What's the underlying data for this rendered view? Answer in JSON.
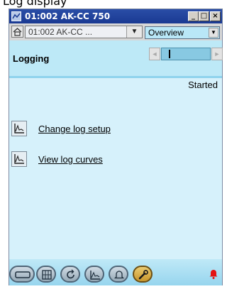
{
  "caption": "Log display",
  "window": {
    "title": "01:002 AK-CC 750",
    "controls": {
      "minimize": "_",
      "maximize": "□",
      "close": "×"
    }
  },
  "nav": {
    "device_selected": "01:002 AK-CC ...",
    "view_selected": "Overview"
  },
  "header": {
    "title": "Logging",
    "pager": {
      "prev": "◄",
      "next": "►",
      "value": ""
    }
  },
  "content": {
    "status": "Started",
    "links": [
      {
        "label": "Change log setup",
        "icon": "chart-icon"
      },
      {
        "label": "View log curves",
        "icon": "chart-icon"
      }
    ]
  },
  "toolbar": {
    "buttons": [
      {
        "icon": "device-icon"
      },
      {
        "icon": "grid-icon"
      },
      {
        "icon": "refresh-icon"
      },
      {
        "icon": "chart-icon",
        "active": true
      },
      {
        "icon": "bell-icon"
      },
      {
        "icon": "wrench-icon"
      }
    ],
    "alarm_icon": "alarm-bell-icon",
    "alarm_color": "#e41313"
  },
  "colors": {
    "title_bar": "#1a3a93",
    "header_bg": "#bde9f7",
    "content_bg": "#d6f1fb",
    "active_tool": "#e5b846"
  }
}
